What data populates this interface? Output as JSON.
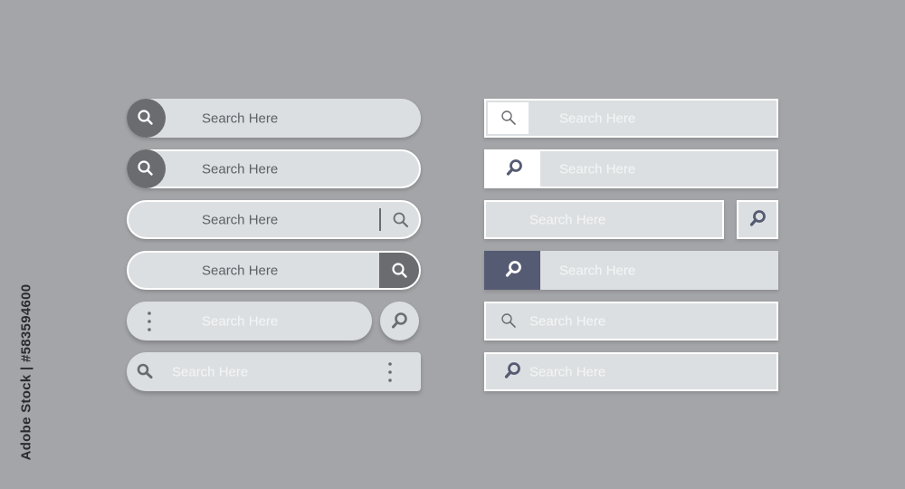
{
  "search_placeholder": "Search Here",
  "left_column": {
    "bars": [
      {
        "label": "Search Here",
        "icon": "search-icon"
      },
      {
        "label": "Search Here",
        "icon": "search-icon"
      },
      {
        "label": "Search Here",
        "icon": "search-icon"
      },
      {
        "label": "Search Here",
        "icon": "search-icon"
      },
      {
        "label": "Search Here",
        "icon": "vertical-dots-icon"
      },
      {
        "label": "Search Here",
        "icon": "search-icon"
      }
    ]
  },
  "right_column": {
    "bars": [
      {
        "label": "Search Here",
        "icon": "search-icon"
      },
      {
        "label": "Search Here",
        "icon": "search-icon"
      },
      {
        "label": "Search Here",
        "icon": "search-icon"
      },
      {
        "label": "Search Here",
        "icon": "search-icon"
      },
      {
        "label": "Search Here",
        "icon": "search-icon"
      },
      {
        "label": "Search Here",
        "icon": "search-icon"
      }
    ]
  },
  "watermark": {
    "id_text": "Adobe Stock | #583594600"
  },
  "colors": {
    "background": "#a4a5a8",
    "bar_fill": "#dcdfe1",
    "dark_gray": "#6b6c70",
    "navy_accent": "#555b73",
    "dark_text": "#5e6065",
    "light_text": "#f4f5f6"
  }
}
